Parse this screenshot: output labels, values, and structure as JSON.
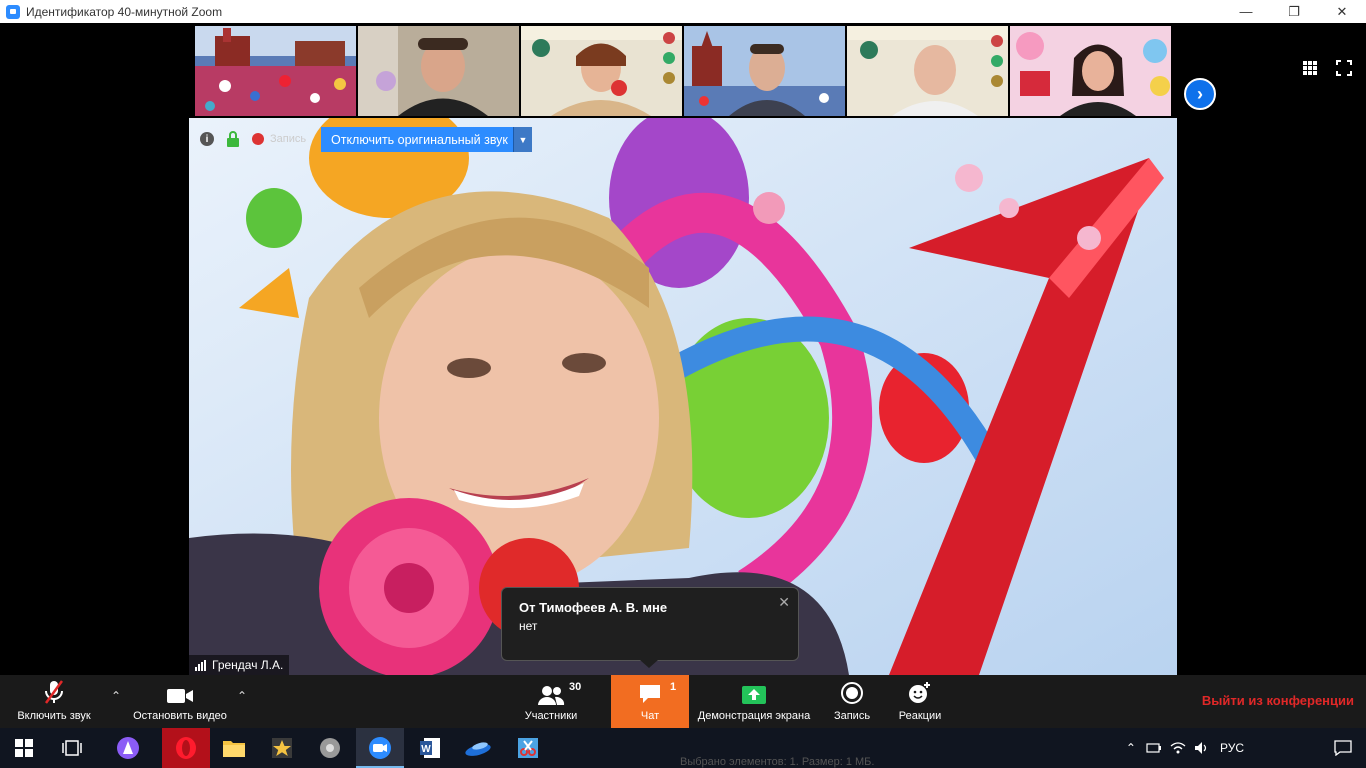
{
  "window": {
    "title": "Идентификатор 40-минутной Zoom",
    "controls": {
      "minimize": "—",
      "restore": "❐",
      "close": "✕"
    }
  },
  "gallery": {
    "thumbnails": [
      {
        "scene": "red-square-crowd"
      },
      {
        "scene": "man-home"
      },
      {
        "scene": "woman-cadet-banner"
      },
      {
        "scene": "man-red-square"
      },
      {
        "scene": "man-cadet-banner"
      },
      {
        "scene": "woman-balloons"
      }
    ],
    "next_icon": "chevron-right-icon"
  },
  "main_video": {
    "speaker_name": "Грендач Л.А.",
    "recording_label": "Запись",
    "original_sound_button": "Отключить оригинальный звук"
  },
  "chat_toast": {
    "from": "От Тимофеев А. В. мне",
    "message": "нет"
  },
  "toolbar": {
    "unmute_label": "Включить звук",
    "stop_video_label": "Остановить видео",
    "participants_label": "Участники",
    "participants_count": "30",
    "chat_label": "Чат",
    "chat_badge": "1",
    "share_label": "Демонстрация экрана",
    "record_label": "Запись",
    "reactions_label": "Реакции",
    "leave_label": "Выйти из конференции"
  },
  "taskbar": {
    "language": "РУС",
    "peek_text": "Выбрано элементов: 1. Размер: 1 МБ."
  },
  "colors": {
    "zoom_blue": "#2d8cff",
    "chat_orange": "#f26d21",
    "leave_red": "#e02828",
    "toolbar_bg": "#1a1a1a"
  }
}
